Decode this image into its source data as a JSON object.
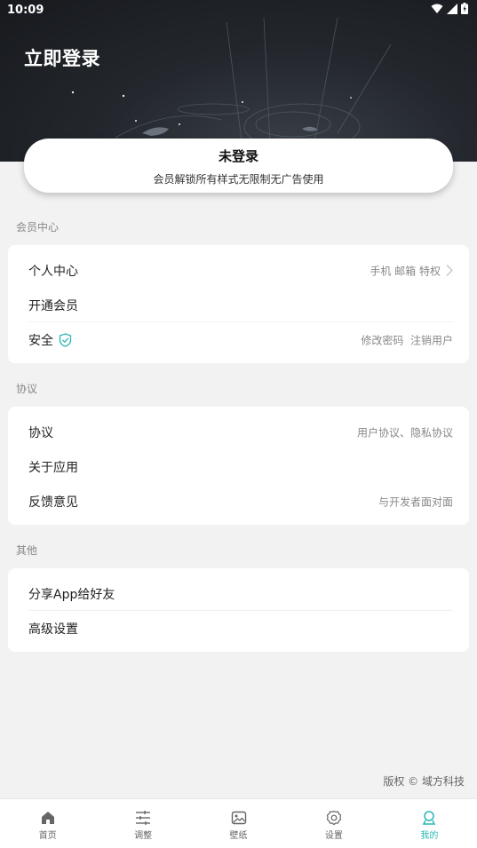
{
  "status_bar": {
    "time": "10:09"
  },
  "header": {
    "title": "立即登录"
  },
  "member_card": {
    "status": "未登录",
    "description": "会员解锁所有样式无限制无广告使用"
  },
  "sections": [
    {
      "title": "会员中心",
      "items": [
        {
          "label": "个人中心",
          "extra": "手机 邮箱 特权",
          "chevron": true
        },
        {
          "label": "开通会员",
          "extra": ""
        },
        {
          "label": "安全",
          "extra": "修改密码  注销用户",
          "icon": "shield-check-icon"
        }
      ]
    },
    {
      "title": "协议",
      "items": [
        {
          "label": "协议",
          "extra": "用户协议、隐私协议"
        },
        {
          "label": "关于应用",
          "extra": ""
        },
        {
          "label": "反馈意见",
          "extra": "与开发者面对面"
        }
      ]
    },
    {
      "title": "其他",
      "items": [
        {
          "label": "分享App给好友",
          "extra": ""
        },
        {
          "label": "高级设置",
          "extra": ""
        }
      ]
    }
  ],
  "copyright": "版权 © 域方科技",
  "nav": [
    {
      "label": "首页",
      "icon": "home-icon"
    },
    {
      "label": "调整",
      "icon": "sliders-icon"
    },
    {
      "label": "壁纸",
      "icon": "image-icon"
    },
    {
      "label": "设置",
      "icon": "gear-icon"
    },
    {
      "label": "我的",
      "icon": "user-icon",
      "active": true
    }
  ],
  "colors": {
    "accent": "#2bb7b4",
    "header_bg": "#1c1f24",
    "page_bg": "#f2f2f2"
  }
}
